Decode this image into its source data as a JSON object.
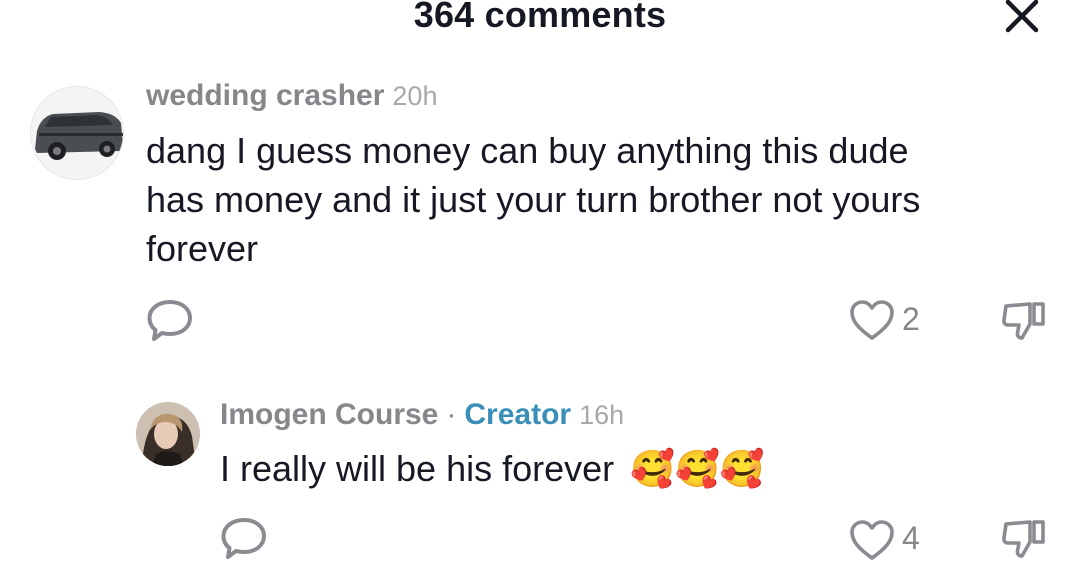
{
  "header": {
    "title": "364 comments",
    "close_icon": "close-icon"
  },
  "comments": [
    {
      "username": "wedding crasher",
      "time": "20h",
      "text": "dang I guess money can buy anything this dude has money and it just your turn brother not yours forever",
      "lines": [
        "dang I guess money can buy anything this dude",
        "has money and it just your turn brother not yours",
        "forever"
      ],
      "likes": "2",
      "icons": [
        "reply-icon",
        "heart-icon",
        "dislike-icon"
      ]
    },
    {
      "username": "Imogen Course",
      "separator": "·",
      "badge": "Creator",
      "time": "16h",
      "text": "I really will be his forever",
      "emojis": "🥰🥰🥰",
      "likes": "4",
      "icons": [
        "reply-icon",
        "heart-icon",
        "dislike-icon"
      ]
    }
  ],
  "colors": {
    "badge": "#3a8fb8",
    "meta": "#86878b",
    "text": "#161823"
  }
}
